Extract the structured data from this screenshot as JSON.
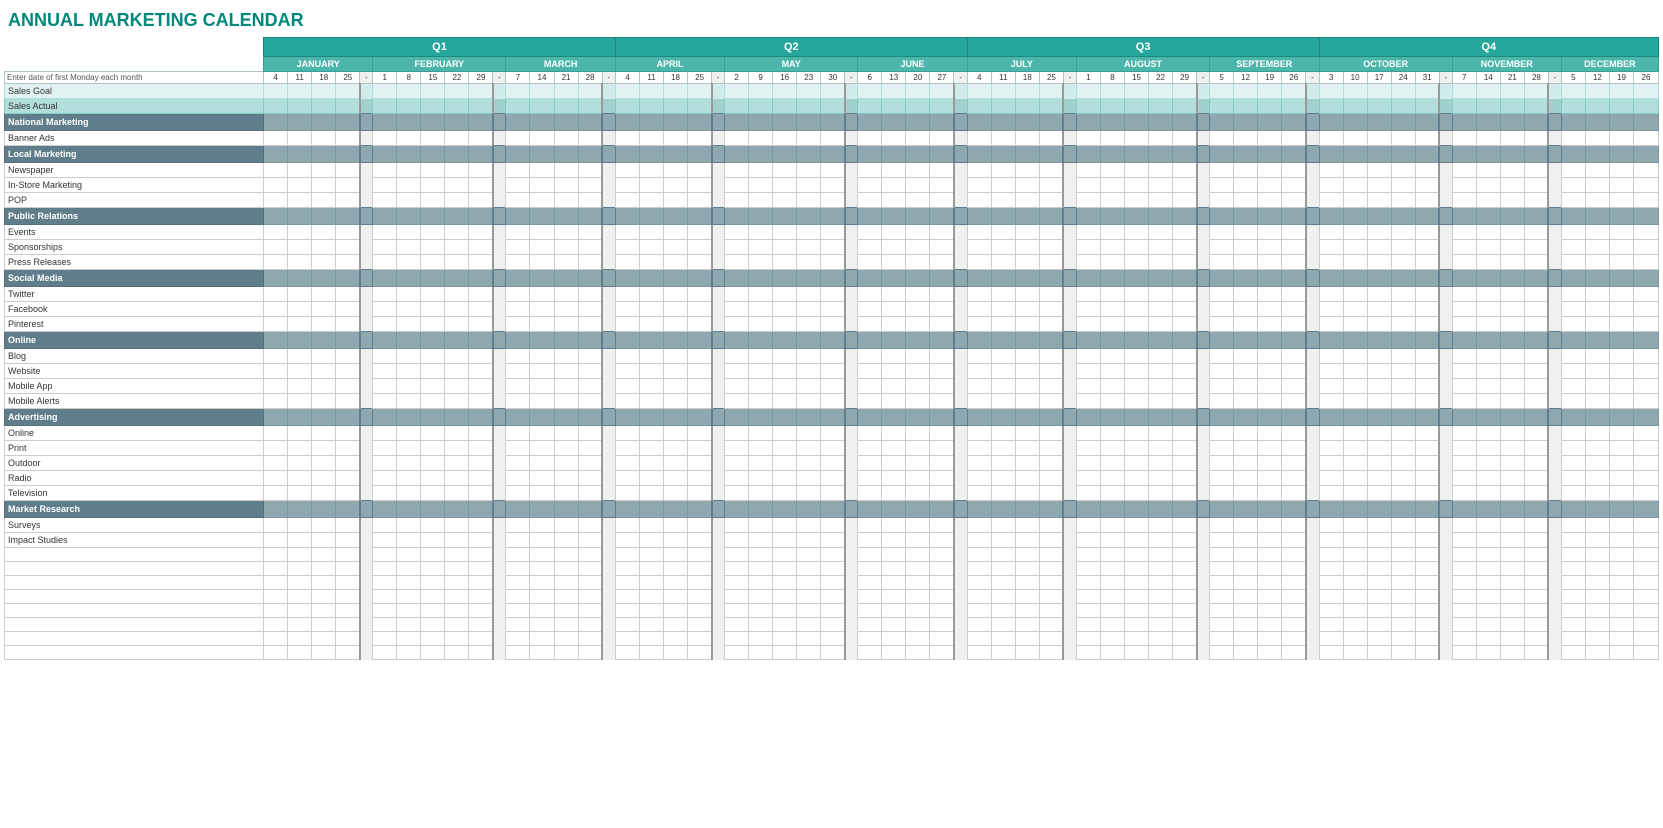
{
  "title": "ANNUAL MARKETING CALENDAR",
  "quarters": [
    {
      "label": "Q1",
      "span": 15
    },
    {
      "label": "Q2",
      "span": 15
    },
    {
      "label": "Q3",
      "span": 15
    },
    {
      "label": "Q4",
      "span": 15
    }
  ],
  "months": [
    {
      "label": "JANUARY",
      "days": [
        "4",
        "11",
        "18",
        "25"
      ],
      "sep": true
    },
    {
      "label": "FEBRUARY",
      "days": [
        "1",
        "8",
        "15",
        "22",
        "29"
      ],
      "sep": true
    },
    {
      "label": "MARCH",
      "days": [
        "7",
        "14",
        "21",
        "28"
      ],
      "sep": true
    },
    {
      "label": "APRIL",
      "days": [
        "4",
        "11",
        "18",
        "25"
      ],
      "sep": true
    },
    {
      "label": "MAY",
      "days": [
        "2",
        "9",
        "16",
        "23",
        "30"
      ],
      "sep": true
    },
    {
      "label": "JUNE",
      "days": [
        "6",
        "13",
        "20",
        "27"
      ],
      "sep": true
    },
    {
      "label": "JULY",
      "days": [
        "4",
        "11",
        "18",
        "25"
      ],
      "sep": true
    },
    {
      "label": "AUGUST",
      "days": [
        "1",
        "8",
        "15",
        "22",
        "29"
      ],
      "sep": true
    },
    {
      "label": "SEPTEMBER",
      "days": [
        "5",
        "12",
        "19",
        "26"
      ],
      "sep": true
    },
    {
      "label": "OCTOBER",
      "days": [
        "3",
        "10",
        "17",
        "24",
        "31"
      ],
      "sep": true
    },
    {
      "label": "NOVEMBER",
      "days": [
        "7",
        "14",
        "21",
        "28"
      ],
      "sep": true
    },
    {
      "label": "DECEMBER",
      "days": [
        "5",
        "12",
        "19",
        "26"
      ],
      "sep": false
    }
  ],
  "date_row_label": "Enter date of first Monday each month",
  "rows": [
    {
      "type": "special",
      "label": "Sales Goal",
      "class": "sales-goal"
    },
    {
      "type": "special",
      "label": "Sales Actual",
      "class": "sales-actual"
    },
    {
      "type": "category",
      "label": "National Marketing"
    },
    {
      "type": "item",
      "label": "Banner Ads"
    },
    {
      "type": "category",
      "label": "Local Marketing"
    },
    {
      "type": "item",
      "label": "Newspaper"
    },
    {
      "type": "item",
      "label": "In-Store Marketing"
    },
    {
      "type": "item",
      "label": "POP"
    },
    {
      "type": "category",
      "label": "Public Relations"
    },
    {
      "type": "item",
      "label": "Events"
    },
    {
      "type": "item",
      "label": "Sponsorships"
    },
    {
      "type": "item",
      "label": "Press Releases"
    },
    {
      "type": "category",
      "label": "Social Media"
    },
    {
      "type": "item",
      "label": "Twitter"
    },
    {
      "type": "item",
      "label": "Facebook"
    },
    {
      "type": "item",
      "label": "Pinterest"
    },
    {
      "type": "category",
      "label": "Online"
    },
    {
      "type": "item",
      "label": "Blog"
    },
    {
      "type": "item",
      "label": "Website"
    },
    {
      "type": "item",
      "label": "Mobile App"
    },
    {
      "type": "item",
      "label": "Mobile Alerts"
    },
    {
      "type": "category",
      "label": "Advertising"
    },
    {
      "type": "item",
      "label": "Online"
    },
    {
      "type": "item",
      "label": "Print"
    },
    {
      "type": "item",
      "label": "Outdoor"
    },
    {
      "type": "item",
      "label": "Radio"
    },
    {
      "type": "item",
      "label": "Television"
    },
    {
      "type": "category",
      "label": "Market Research"
    },
    {
      "type": "item",
      "label": "Surveys"
    },
    {
      "type": "item",
      "label": "Impact Studies"
    },
    {
      "type": "empty",
      "label": ""
    },
    {
      "type": "empty",
      "label": ""
    },
    {
      "type": "empty",
      "label": ""
    },
    {
      "type": "empty",
      "label": ""
    },
    {
      "type": "empty",
      "label": ""
    },
    {
      "type": "empty",
      "label": ""
    },
    {
      "type": "empty",
      "label": ""
    },
    {
      "type": "empty",
      "label": ""
    }
  ]
}
